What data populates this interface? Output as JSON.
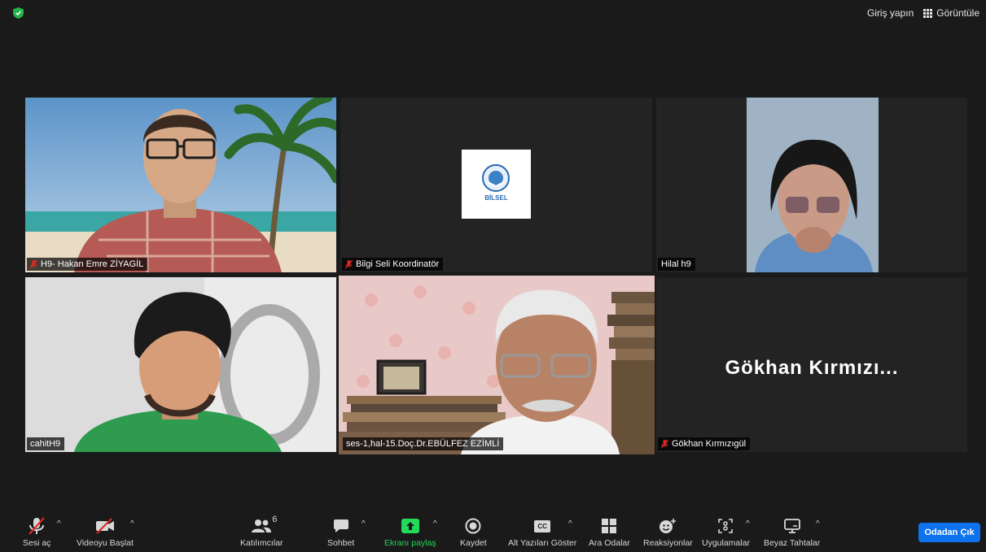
{
  "topbar": {
    "signin_label": "Giriş yapın",
    "view_label": "Görüntüle"
  },
  "tiles": [
    {
      "name": "H9- Hakan Emre ZİYAGİL",
      "muted": true
    },
    {
      "name": "Bilgi Seli Koordinatör",
      "muted": true,
      "logo_text": "BİLSEL"
    },
    {
      "name": "Hilal h9",
      "muted": false
    },
    {
      "name": "cahitH9",
      "muted": false
    },
    {
      "name": "ses-1,hal-15.Doç.Dr.EBÜLFEZ EZİMLİ",
      "muted": false,
      "active": true
    },
    {
      "name": "Gökhan Kırmızıgül",
      "muted": true,
      "display_name": "Gökhan Kırmızı..."
    }
  ],
  "toolbar": {
    "audio_label": "Sesi aç",
    "video_label": "Videoyu Başlat",
    "participants_label": "Katılımcılar",
    "participants_count": "6",
    "chat_label": "Sohbet",
    "share_label": "Ekranı paylaş",
    "record_label": "Kaydet",
    "captions_label": "Alt Yazıları Göster",
    "captions_icon_text": "CC",
    "breakout_label": "Ara Odalar",
    "reactions_label": "Reaksiyonlar",
    "apps_label": "Uygulamalar",
    "whiteboard_label": "Beyaz Tahtalar",
    "leave_label": "Odadan Çık"
  },
  "colors": {
    "accent": "#0e72ed",
    "share_green": "#23d959",
    "active_border": "#d6e58a",
    "muted_red": "#e02828"
  }
}
